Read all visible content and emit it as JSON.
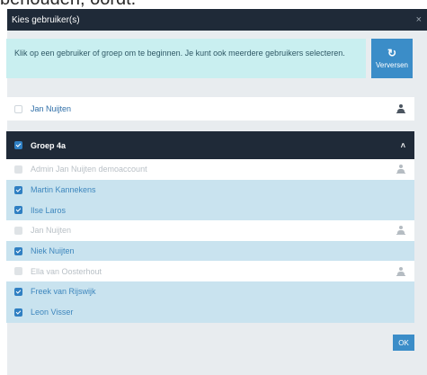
{
  "backdrop": {
    "text": "behouden, oordt."
  },
  "dialog": {
    "title": "Kies gebruiker(s)",
    "close": "×",
    "info": "Klik op een gebruiker of groep om te beginnen. Je kunt ook meerdere gebruikers selecteren.",
    "refresh_label": "Verversen",
    "ok_label": "OK"
  },
  "single_user": {
    "name": "Jan Nuijten",
    "selected": false
  },
  "group": {
    "name": "Groep 4a",
    "selected": true,
    "expanded": true,
    "members": [
      {
        "name": "Admin Jan Nuijten demoaccount",
        "selected": false,
        "icon": "person-icon"
      },
      {
        "name": "Martin Kannekens",
        "selected": true
      },
      {
        "name": "Ilse Laros",
        "selected": true
      },
      {
        "name": "Jan Nuijten",
        "selected": false,
        "icon": "person-icon"
      },
      {
        "name": "Niek Nuijten",
        "selected": true
      },
      {
        "name": "Ella van Oosterhout",
        "selected": false,
        "icon": "person-icon"
      },
      {
        "name": "Freek van Rijswijk",
        "selected": true
      },
      {
        "name": "Leon Visser",
        "selected": true
      }
    ]
  },
  "colors": {
    "header": "#1f2a38",
    "accent": "#3b8dc8",
    "info_bg": "#c9eff0",
    "selected_row": "#c9e3ef"
  }
}
